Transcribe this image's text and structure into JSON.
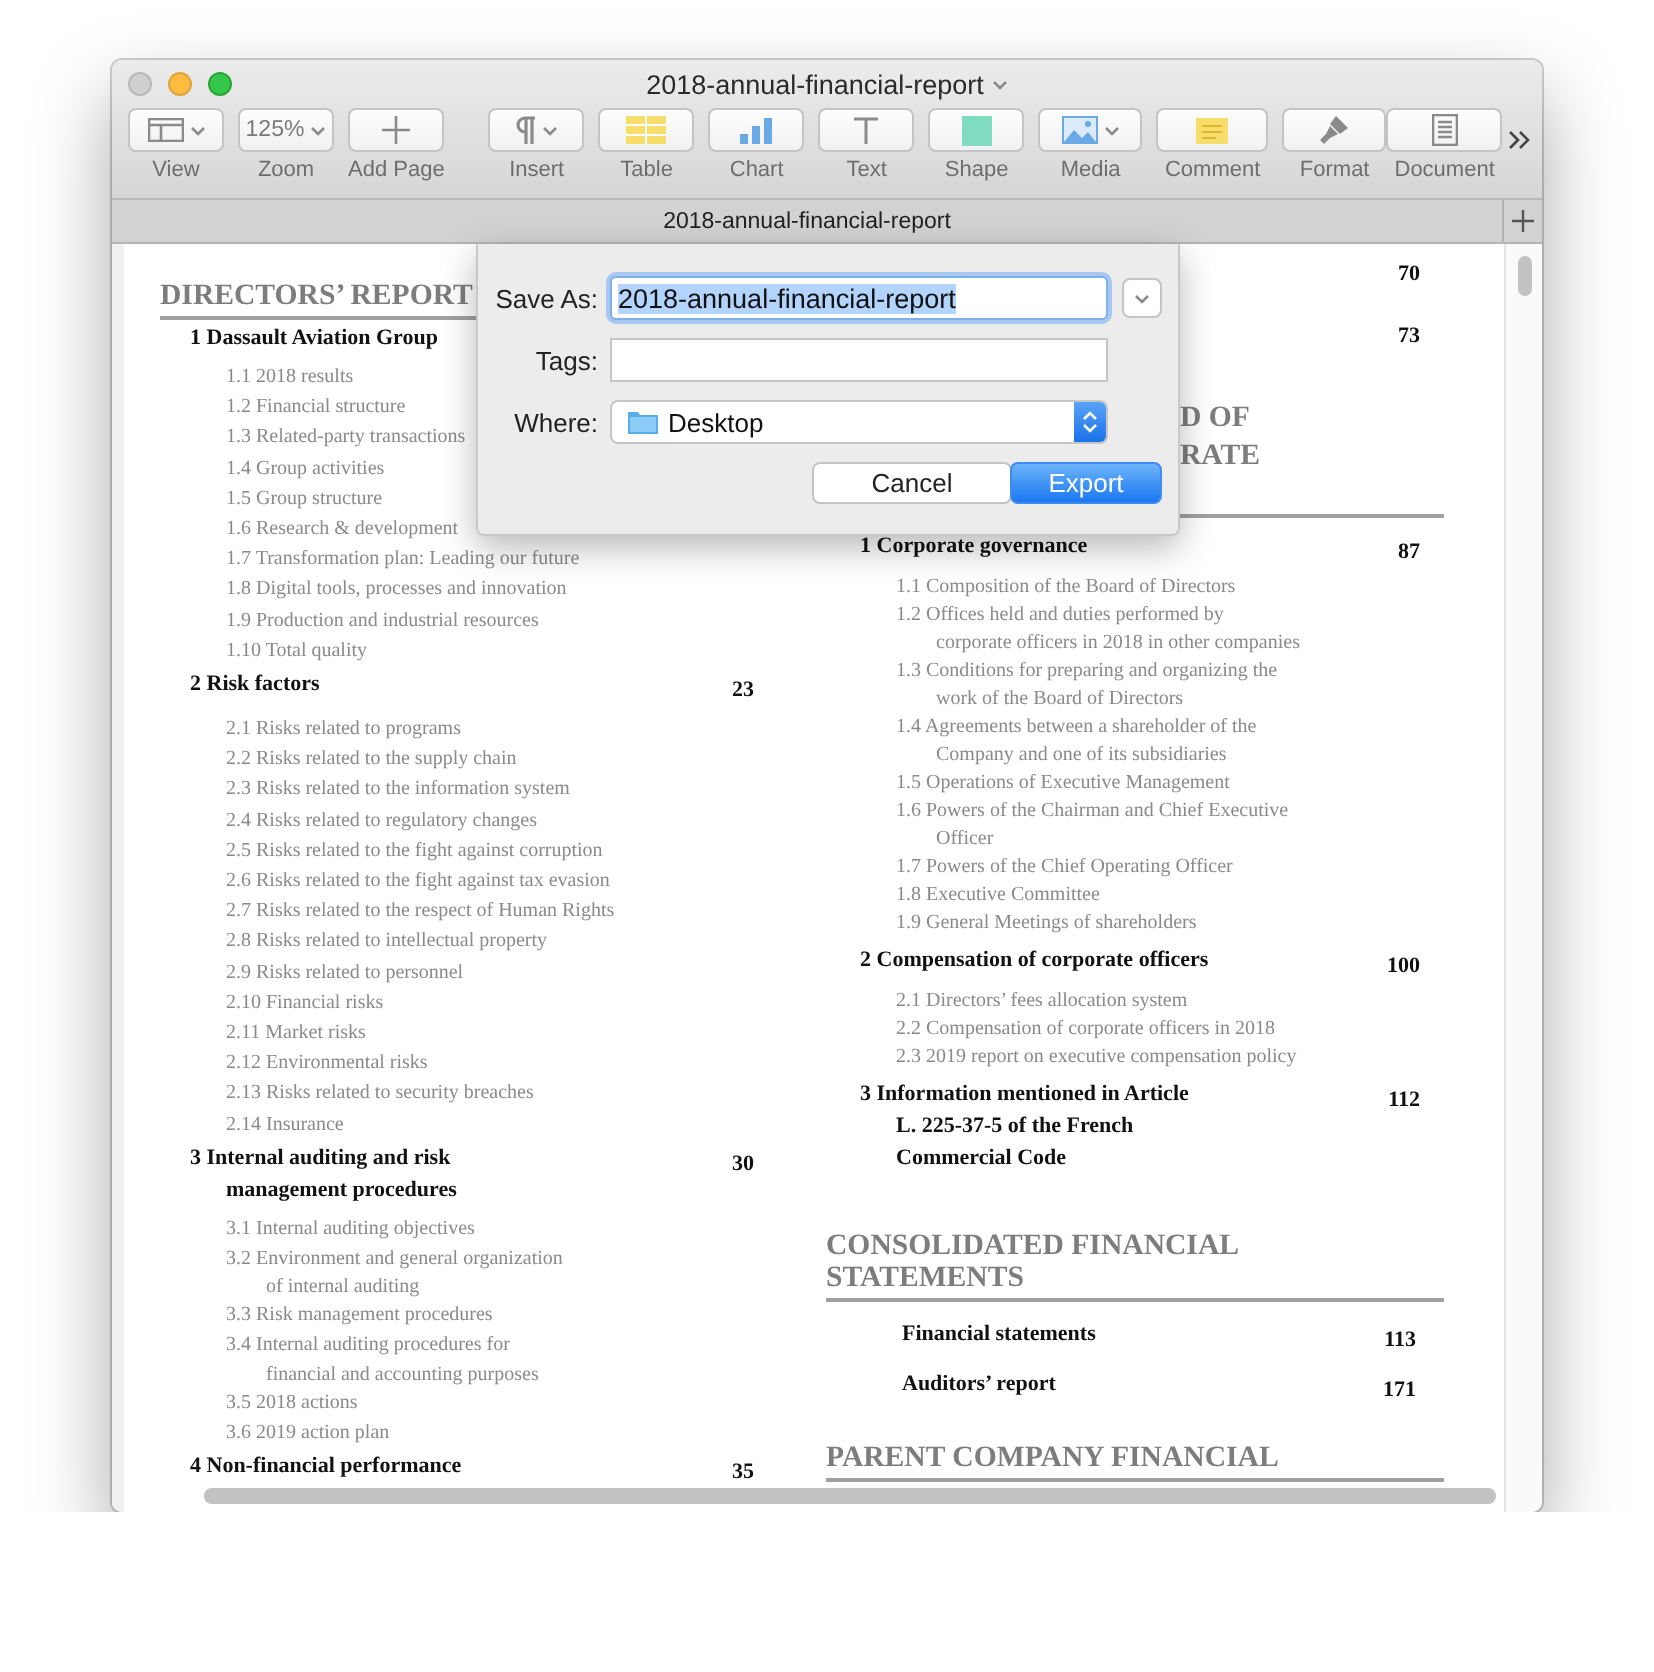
{
  "window": {
    "title": "2018-annual-financial-report"
  },
  "toolbar": [
    {
      "kind": "view",
      "label": "View"
    },
    {
      "kind": "zoom",
      "label": "Zoom",
      "value": "125%"
    },
    {
      "kind": "add-page",
      "label": "Add Page"
    },
    {
      "kind": "insert",
      "label": "Insert"
    },
    {
      "kind": "table",
      "label": "Table"
    },
    {
      "kind": "chart",
      "label": "Chart"
    },
    {
      "kind": "text",
      "label": "Text"
    },
    {
      "kind": "shape",
      "label": "Shape"
    },
    {
      "kind": "media",
      "label": "Media"
    },
    {
      "kind": "comment",
      "label": "Comment"
    },
    {
      "kind": "format",
      "label": "Format"
    },
    {
      "kind": "document",
      "label": "Document"
    }
  ],
  "tab_bar": {
    "tabs": [
      {
        "label": "2018-annual-financial-report",
        "selected": true
      }
    ]
  },
  "document": {
    "left_column": [
      {
        "kind": "heading",
        "lines": [
          "DIRECTORS’ REPORT"
        ]
      },
      {
        "kind": "section",
        "title_lines": [
          "1 Dassault Aviation Group"
        ],
        "items": [
          {
            "lines": [
              "1.1 2018 results"
            ]
          },
          {
            "lines": [
              "1.2 Financial structure"
            ]
          },
          {
            "lines": [
              "1.3 Related-party transactions"
            ]
          },
          {
            "lines": [
              "1.4 Group activities"
            ]
          },
          {
            "lines": [
              "1.5 Group structure"
            ]
          },
          {
            "lines": [
              "1.6 Research & development"
            ]
          },
          {
            "lines": [
              "1.7 Transformation plan: Leading our future"
            ]
          },
          {
            "lines": [
              "1.8 Digital tools, processes and innovation"
            ]
          },
          {
            "lines": [
              "1.9 Production and industrial resources"
            ]
          },
          {
            "lines": [
              "1.10 Total quality"
            ]
          }
        ]
      },
      {
        "kind": "section",
        "title_lines": [
          "2 Risk factors"
        ],
        "page": "23",
        "items": [
          {
            "lines": [
              "2.1 Risks related to programs"
            ]
          },
          {
            "lines": [
              "2.2 Risks related to the supply chain"
            ]
          },
          {
            "lines": [
              "2.3 Risks related to the information system"
            ]
          },
          {
            "lines": [
              "2.4 Risks related to regulatory changes"
            ]
          },
          {
            "lines": [
              "2.5 Risks related to the fight against corruption"
            ]
          },
          {
            "lines": [
              "2.6 Risks related to the fight against tax evasion"
            ]
          },
          {
            "lines": [
              "2.7 Risks related to the respect of Human Rights"
            ]
          },
          {
            "lines": [
              "2.8 Risks related to intellectual property"
            ]
          },
          {
            "lines": [
              "2.9 Risks related to personnel"
            ]
          },
          {
            "lines": [
              "2.10 Financial risks"
            ]
          },
          {
            "lines": [
              "2.11 Market risks"
            ]
          },
          {
            "lines": [
              "2.12 Environmental risks"
            ]
          },
          {
            "lines": [
              "2.13 Risks related to security breaches"
            ]
          },
          {
            "lines": [
              "2.14 Insurance"
            ]
          }
        ]
      },
      {
        "kind": "section",
        "title_lines": [
          "3 Internal auditing and risk",
          "management procedures"
        ],
        "page": "30",
        "items": [
          {
            "lines": [
              "3.1 Internal auditing objectives"
            ]
          },
          {
            "lines": [
              "3.2 Environment and general organization",
              "of internal auditing"
            ]
          },
          {
            "lines": [
              "3.3 Risk management procedures"
            ]
          },
          {
            "lines": [
              "3.4 Internal auditing procedures for",
              "financial and accounting purposes"
            ]
          },
          {
            "lines": [
              "3.5 2018 actions"
            ]
          },
          {
            "lines": [
              "3.6 2019 action plan"
            ]
          }
        ]
      },
      {
        "kind": "section",
        "title_lines": [
          "4 Non-financial performance"
        ],
        "page": "35"
      }
    ],
    "right_column": [
      {
        "kind": "page-only",
        "page": "70"
      },
      {
        "kind": "page-only",
        "page": "73"
      },
      {
        "kind": "cut-heading",
        "lines": [
          "D OF",
          "RATE"
        ]
      },
      {
        "kind": "section",
        "title_lines": [
          "1 Corporate governance"
        ],
        "page": "87",
        "items": [
          {
            "lines": [
              "1.1 Composition of the Board of Directors"
            ]
          },
          {
            "lines": [
              "1.2 Offices held and duties performed by",
              "corporate officers in 2018 in other companies"
            ]
          },
          {
            "lines": [
              "1.3 Conditions for preparing and organizing the",
              "work of the Board of Directors"
            ]
          },
          {
            "lines": [
              "1.4 Agreements between a shareholder of the",
              "Company and one of its subsidiaries"
            ]
          },
          {
            "lines": [
              "1.5 Operations of Executive Management"
            ]
          },
          {
            "lines": [
              "1.6 Powers of the Chairman and Chief Executive",
              "Officer"
            ]
          },
          {
            "lines": [
              "1.7 Powers of the Chief Operating Officer"
            ]
          },
          {
            "lines": [
              "1.8 Executive Committee"
            ]
          },
          {
            "lines": [
              "1.9 General Meetings of shareholders"
            ]
          }
        ]
      },
      {
        "kind": "section",
        "title_lines": [
          "2 Compensation of corporate officers"
        ],
        "page": "100",
        "items": [
          {
            "lines": [
              "2.1 Directors’ fees allocation system"
            ]
          },
          {
            "lines": [
              "2.2 Compensation of corporate officers in 2018"
            ]
          },
          {
            "lines": [
              "2.3 2019 report on executive compensation policy"
            ]
          }
        ]
      },
      {
        "kind": "section",
        "title_lines": [
          "3 Information mentioned in Article",
          "L. 225-37-5 of the French",
          "Commercial Code"
        ],
        "page": "112"
      },
      {
        "kind": "heading",
        "lines": [
          "CONSOLIDATED FINANCIAL",
          "STATEMENTS"
        ]
      },
      {
        "kind": "entry",
        "title": "Financial statements",
        "page": "113"
      },
      {
        "kind": "entry",
        "title": "Auditors’ report",
        "page": "171"
      },
      {
        "kind": "heading",
        "lines": [
          "PARENT COMPANY FINANCIAL"
        ]
      }
    ]
  },
  "dialog": {
    "save_as": {
      "label": "Save As:",
      "value": "2018-annual-financial-report",
      "focused": true,
      "text_selected": true
    },
    "tags": {
      "label": "Tags:"
    },
    "where": {
      "label": "Where:",
      "value": "Desktop"
    },
    "buttons": [
      {
        "label": "Cancel",
        "default": false
      },
      {
        "label": "Export",
        "default": true
      }
    ]
  }
}
